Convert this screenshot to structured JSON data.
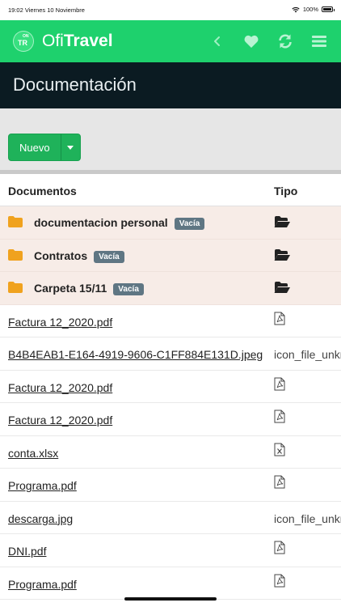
{
  "status_bar": {
    "time": "19:02 Viernes 10 Noviembre",
    "battery": "100%"
  },
  "app": {
    "logo_small": "ON",
    "logo_big": "TR",
    "brand_part1": "Ofi",
    "brand_part2": "Travel",
    "accent_color": "#1ed16d",
    "header_icons": [
      "back-icon",
      "heart-icon",
      "refresh-icon",
      "menu-icon"
    ]
  },
  "page": {
    "title": "Documentación"
  },
  "toolbar": {
    "new_label": "Nuevo"
  },
  "table": {
    "col_documents": "Documentos",
    "col_type": "Tipo",
    "folders": [
      {
        "name": "documentacion personal",
        "badge": "Vacía"
      },
      {
        "name": "Contratos",
        "badge": "Vacía"
      },
      {
        "name": "Carpeta 15/11",
        "badge": "Vacía"
      }
    ],
    "files": [
      {
        "name": "Factura 12_2020.pdf",
        "type_icon": "pdf-icon"
      },
      {
        "name": "B4B4EAB1-E164-4919-9606-C1FF884E131D.jpeg",
        "type_text": "icon_file_unknown"
      },
      {
        "name": "Factura 12_2020.pdf",
        "type_icon": "pdf-icon"
      },
      {
        "name": "Factura 12_2020.pdf",
        "type_icon": "pdf-icon"
      },
      {
        "name": "conta.xlsx",
        "type_icon": "excel-icon"
      },
      {
        "name": "Programa.pdf",
        "type_icon": "pdf-icon"
      },
      {
        "name": "descarga.jpg",
        "type_text": "icon_file_unknown"
      },
      {
        "name": "DNI.pdf",
        "type_icon": "pdf-icon"
      },
      {
        "name": "Programa.pdf",
        "type_icon": "pdf-icon"
      }
    ]
  }
}
